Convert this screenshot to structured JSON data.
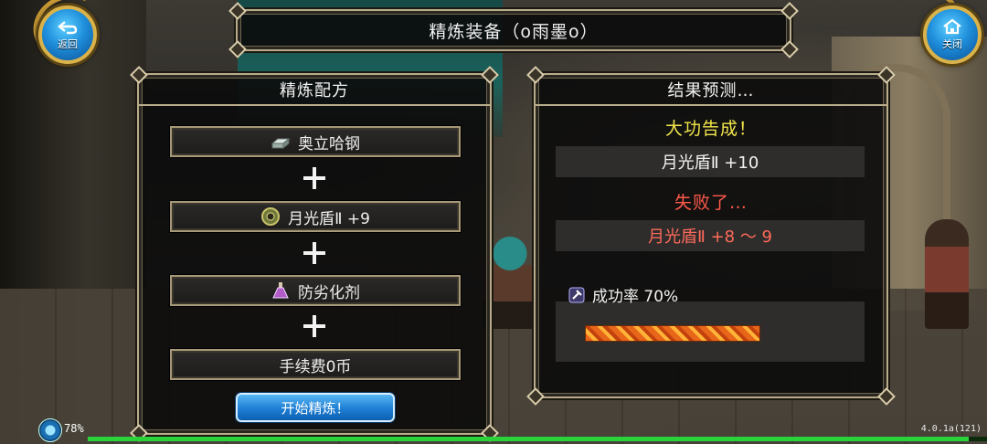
{
  "header": {
    "title": "精炼装备（o雨墨o）"
  },
  "nav": {
    "back_label": "返回",
    "close_label": "关闭"
  },
  "recipe": {
    "title": "精炼配方",
    "slots": [
      {
        "icon": "steel-ingot-icon",
        "label": "奥立哈钢"
      },
      {
        "icon": "shield-icon",
        "label": "月光盾Ⅱ  +9"
      },
      {
        "icon": "potion-icon",
        "label": "防劣化剂"
      },
      {
        "icon": "",
        "label": "手续费0币"
      }
    ],
    "start_label": "开始精炼！"
  },
  "result": {
    "title": "结果预测…",
    "success_text": "大功告成！",
    "success_item": "月光盾Ⅱ  +10",
    "fail_text": "失败了…",
    "fail_item": "月光盾Ⅱ  +8 ～ 9",
    "rate_label": "成功率 70%",
    "rate_value": 0.7
  },
  "status": {
    "battery": "78%",
    "version": "4.0.1a(121)",
    "load_fraction": 0.98
  },
  "colors": {
    "success": "#f2e64a",
    "fail": "#ff5a4a",
    "fail_item": "#ff6a5a",
    "accent_blue": "#1e7fd4",
    "frame_gold": "#b9ac8b"
  }
}
